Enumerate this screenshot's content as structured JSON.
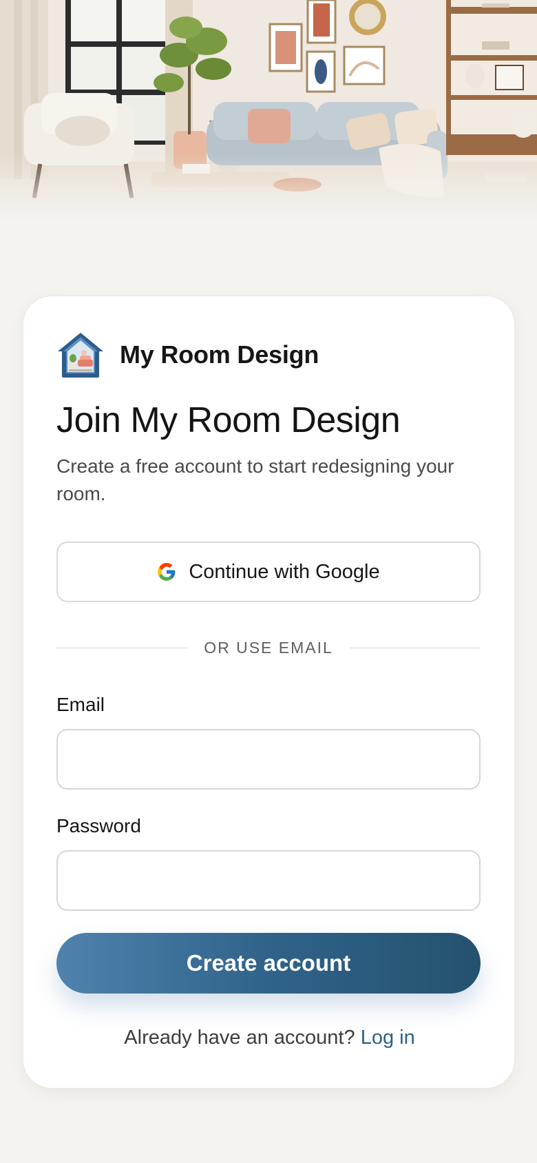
{
  "brand": {
    "name": "My Room Design",
    "logo_icon": "house-logo-icon"
  },
  "signup": {
    "title": "Join My Room Design",
    "subtitle": "Create a free account to start redesigning your room.",
    "google_button_label": "Continue with Google",
    "google_icon": "google-g-icon",
    "divider_label": "OR USE EMAIL",
    "email_label": "Email",
    "email_value": "",
    "password_label": "Password",
    "password_value": "",
    "submit_label": "Create account",
    "login_prompt": "Already have an account?",
    "login_link_label": "Log in"
  },
  "colors": {
    "accent_start": "#4f82ae",
    "accent_end": "#25516f",
    "link": "#2b618a",
    "background": "#f5f3ef"
  }
}
